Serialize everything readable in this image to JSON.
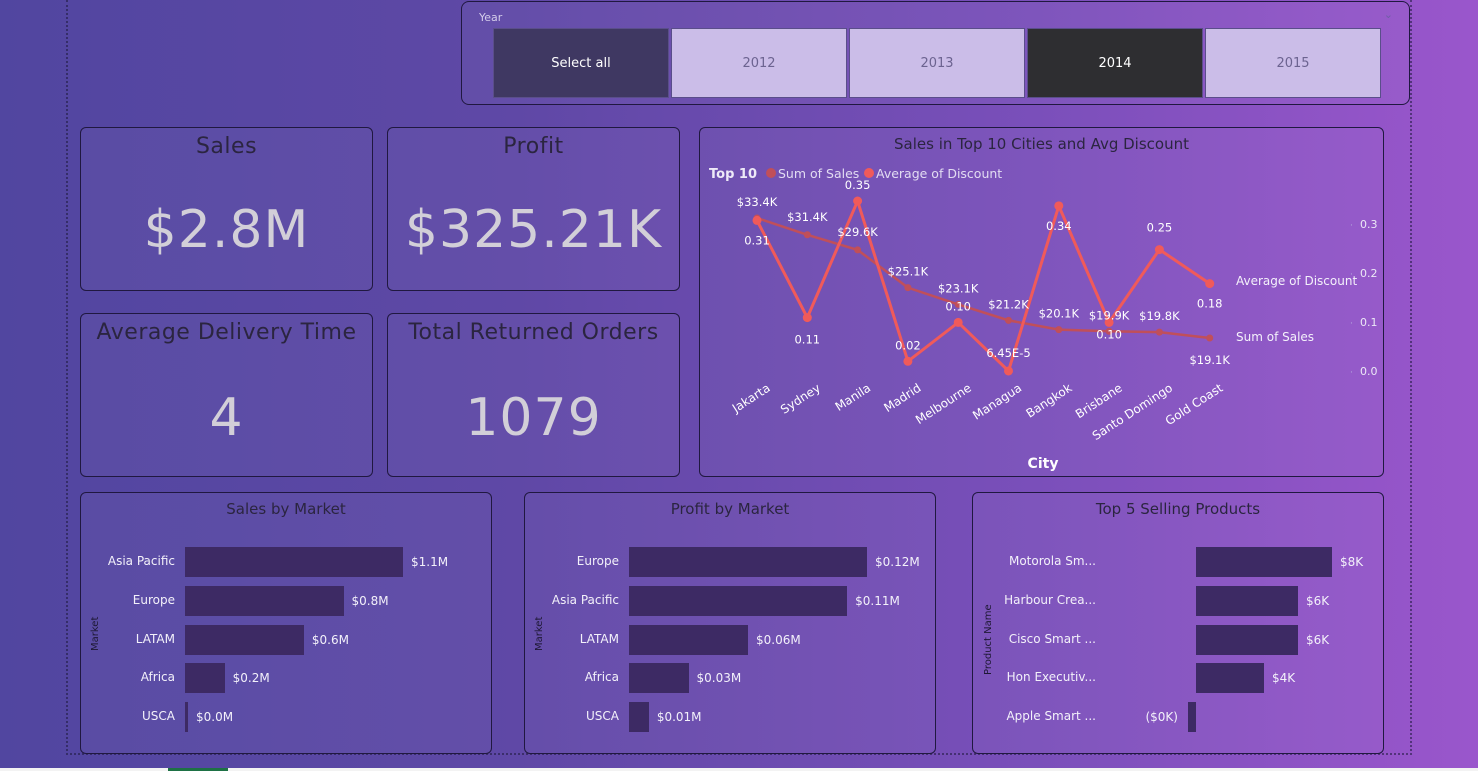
{
  "slicer": {
    "title": "Year",
    "options": [
      "Select all",
      "2012",
      "2013",
      "2014",
      "2015"
    ],
    "selected": "2014"
  },
  "kpis": {
    "sales": {
      "title": "Sales",
      "value": "$2.8M"
    },
    "profit": {
      "title": "Profit",
      "value": "$325.21K"
    },
    "delivery": {
      "title": "Average Delivery Time",
      "value": "4"
    },
    "returns": {
      "title": "Total Returned Orders",
      "value": "1079"
    }
  },
  "colors": {
    "bar": "#3d2a64",
    "sales_line": "#c04f5a",
    "discount_line": "#f05a5a",
    "slicer_selected": "#2e2e31",
    "slicer_unselected": "#cbbde8"
  },
  "chart_data": [
    {
      "type": "line",
      "title": "Sales in Top 10 Cities and Avg Discount",
      "legend_title": "Top 10",
      "legend_placement": "top-left",
      "xlabel": "City",
      "categories": [
        "Jakarta",
        "Sydney",
        "Manila",
        "Madrid",
        "Melbourne",
        "Managua",
        "Bangkok",
        "Brisbane",
        "Santo Domingo",
        "Gold Coast"
      ],
      "series": [
        {
          "name": "Sum of Sales",
          "end_label": "Sum of Sales",
          "values": [
            33400,
            31400,
            29600,
            25100,
            23100,
            21200,
            20100,
            19900,
            19800,
            19100
          ],
          "labels": [
            "$33.4K",
            "$31.4K",
            "$29.6K",
            "$25.1K",
            "$23.1K",
            "$21.2K",
            "$20.1K",
            "$19.9K",
            "$19.8K",
            "$19.1K"
          ]
        },
        {
          "name": "Average of Discount",
          "end_label": "Average of Discount",
          "values": [
            0.31,
            0.11,
            0.35,
            0.02,
            0.1,
            6.45e-05,
            0.34,
            0.1,
            0.25,
            0.18
          ],
          "labels": [
            "0.31",
            "0.11",
            "0.35",
            "0.02",
            "0.10",
            "6.45E-5",
            "0.34",
            "0.10",
            "0.25",
            "0.18"
          ]
        }
      ],
      "y2_ticks": [
        "0.0",
        "0.1",
        "0.2",
        "0.3"
      ],
      "y2lim": [
        0,
        0.35
      ]
    },
    {
      "type": "bar",
      "title": "Sales by Market",
      "ylabel": "Market",
      "categories": [
        "Asia Pacific",
        "Europe",
        "LATAM",
        "Africa",
        "USCA"
      ],
      "values": [
        1.1,
        0.8,
        0.6,
        0.2,
        0.0
      ],
      "labels": [
        "$1.1M",
        "$0.8M",
        "$0.6M",
        "$0.2M",
        "$0.0M"
      ]
    },
    {
      "type": "bar",
      "title": "Profit by Market",
      "ylabel": "Market",
      "categories": [
        "Europe",
        "Asia Pacific",
        "LATAM",
        "Africa",
        "USCA"
      ],
      "values": [
        0.12,
        0.11,
        0.06,
        0.03,
        0.01
      ],
      "labels": [
        "$0.12M",
        "$0.11M",
        "$0.06M",
        "$0.03M",
        "$0.01M"
      ]
    },
    {
      "type": "bar",
      "title": "Top 5 Selling Products",
      "ylabel": "Product Name",
      "categories": [
        "Motorola Sm...",
        "Harbour Crea...",
        "Cisco Smart ...",
        "Hon Executiv...",
        "Apple Smart ..."
      ],
      "values": [
        8,
        6,
        6,
        4,
        -0.4
      ],
      "labels": [
        "$8K",
        "$6K",
        "$6K",
        "$4K",
        "($0K)"
      ]
    }
  ]
}
